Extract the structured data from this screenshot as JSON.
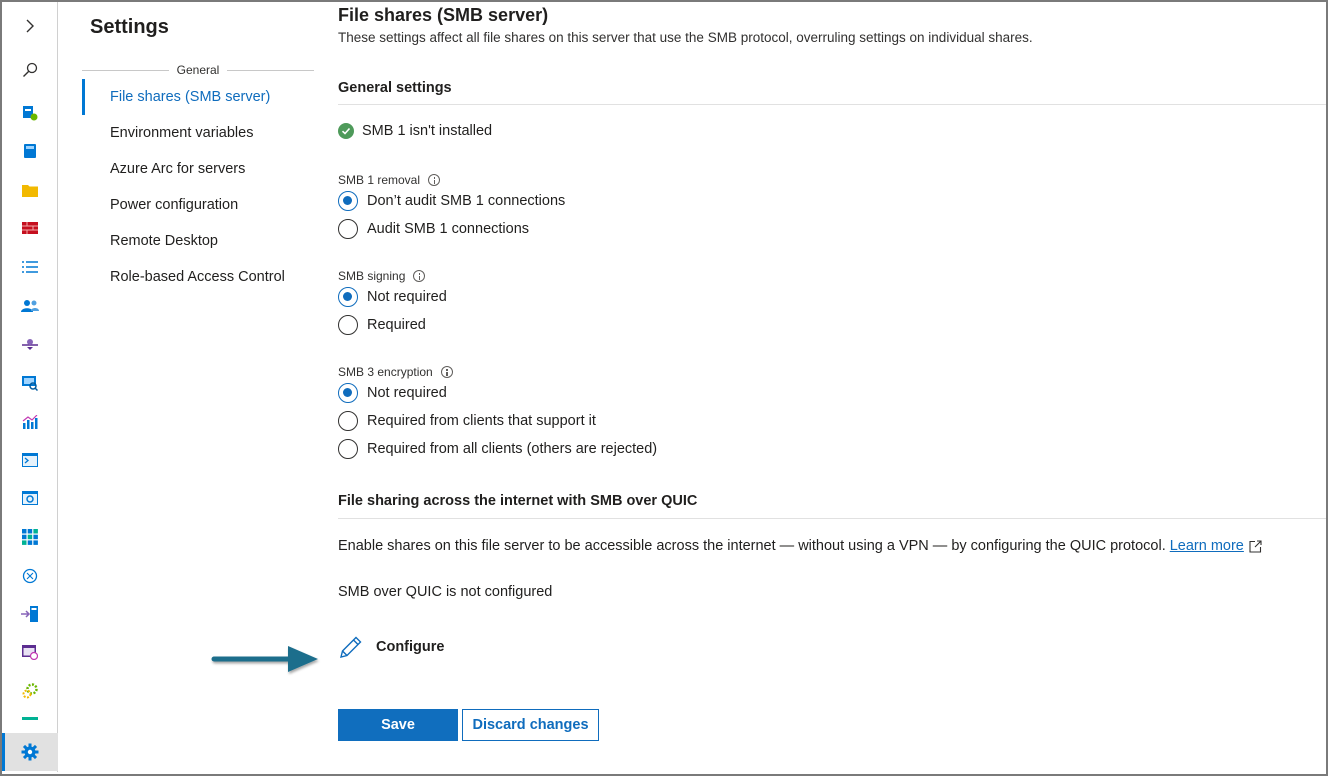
{
  "rail": {
    "items": [
      {
        "icon": "expand-chevron-icon",
        "color": "#323130"
      },
      {
        "icon": "search-icon",
        "color": "#323130"
      },
      {
        "icon": "server-manager-icon",
        "color": "#0078d4"
      },
      {
        "icon": "book-icon",
        "color": "#0078d4"
      },
      {
        "icon": "folder-icon",
        "color": "#f2b900"
      },
      {
        "icon": "firewall-icon",
        "color": "#c50f1f"
      },
      {
        "icon": "list-icon",
        "color": "#0078d4"
      },
      {
        "icon": "users-icon",
        "color": "#0078d4"
      },
      {
        "icon": "network-icon",
        "color": "#5c2d91"
      },
      {
        "icon": "remote-desktop-icon",
        "color": "#0078d4"
      },
      {
        "icon": "performance-icon",
        "color": "#0078d4"
      },
      {
        "icon": "powershell-icon",
        "color": "#0078d4"
      },
      {
        "icon": "services-icon",
        "color": "#0078d4"
      },
      {
        "icon": "apps-grid-icon",
        "color": "#0078d4"
      },
      {
        "icon": "updates-icon",
        "color": "#0078d4"
      },
      {
        "icon": "storage-migration-icon",
        "color": "#0078d4"
      },
      {
        "icon": "scheduled-tasks-icon",
        "color": "#5c2d91"
      },
      {
        "icon": "roles-features-icon",
        "color": "#6bb700"
      },
      {
        "icon": "partial-item-icon",
        "color": "#00b294"
      },
      {
        "icon": "settings-gear-icon",
        "color": "#0078d4"
      }
    ]
  },
  "settings": {
    "title": "Settings",
    "group_label": "General",
    "nav": [
      "File shares (SMB server)",
      "Environment variables",
      "Azure Arc for servers",
      "Power configuration",
      "Remote Desktop",
      "Role-based Access Control"
    ]
  },
  "main": {
    "title": "File shares (SMB server)",
    "description": "These settings affect all file shares on this server that use the SMB protocol, overruling settings on individual shares.",
    "general_heading": "General settings",
    "smb1_status": "SMB 1 isn't installed",
    "smb1_removal": {
      "label": "SMB 1 removal",
      "options": [
        "Don’t audit SMB 1 connections",
        "Audit SMB 1 connections"
      ],
      "selected": 0
    },
    "smb_signing": {
      "label": "SMB signing",
      "options": [
        "Not required",
        "Required"
      ],
      "selected": 0
    },
    "smb3_encryption": {
      "label": "SMB 3 encryption",
      "options": [
        "Not required",
        "Required from clients that support it",
        "Required from all clients (others are rejected)"
      ],
      "selected": 0
    },
    "quic_heading": "File sharing across the internet with SMB over QUIC",
    "quic_description": "Enable shares on this file server to be accessible across the internet — without using a VPN — by configuring the QUIC protocol.",
    "learn_more": "Learn more",
    "quic_status": "SMB over QUIC is not configured",
    "configure_label": "Configure",
    "save_label": "Save",
    "discard_label": "Discard changes"
  },
  "colors": {
    "accent": "#0f6cbd",
    "primary_button": "#106ebe",
    "success": "#4e9a5a",
    "arrow": "#1f6e8c"
  }
}
